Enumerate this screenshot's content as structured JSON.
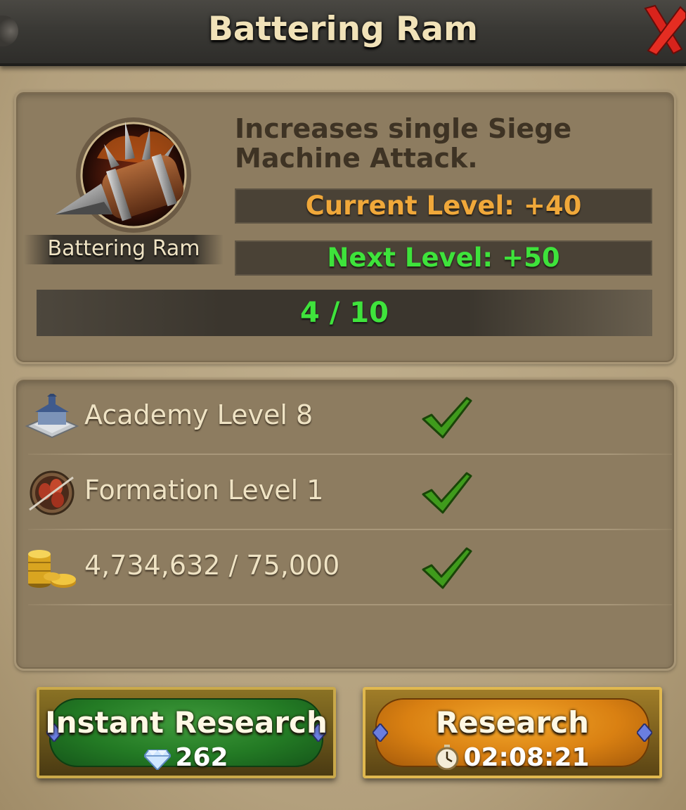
{
  "window": {
    "title": "Battering Ram",
    "close_icon": "close-x-icon"
  },
  "research": {
    "icon_name": "battering-ram-icon",
    "name": "Battering Ram",
    "description": "Increases single Siege Machine Attack.",
    "current_level": "Current Level: +40",
    "next_level": "Next Level: +50",
    "progress_text": "4 / 10",
    "progress_current": 4,
    "progress_max": 10
  },
  "requirements": [
    {
      "icon": "academy-building-icon",
      "label": "Academy Level 8",
      "met": true
    },
    {
      "icon": "formation-icon",
      "label": "Formation Level 1",
      "met": true
    },
    {
      "icon": "gold-coins-icon",
      "label": "4,734,632 / 75,000",
      "met": true
    }
  ],
  "buttons": {
    "instant": {
      "label": "Instant Research",
      "cost": "262",
      "cost_icon": "gem-icon"
    },
    "research": {
      "label": "Research",
      "time": "02:08:21",
      "time_icon": "stopwatch-icon"
    }
  },
  "colors": {
    "current_level": "#f0a83a",
    "next_level": "#3ee33b",
    "progress_text": "#3fe33c",
    "instant_button": "#237a24",
    "research_button": "#d98012"
  }
}
